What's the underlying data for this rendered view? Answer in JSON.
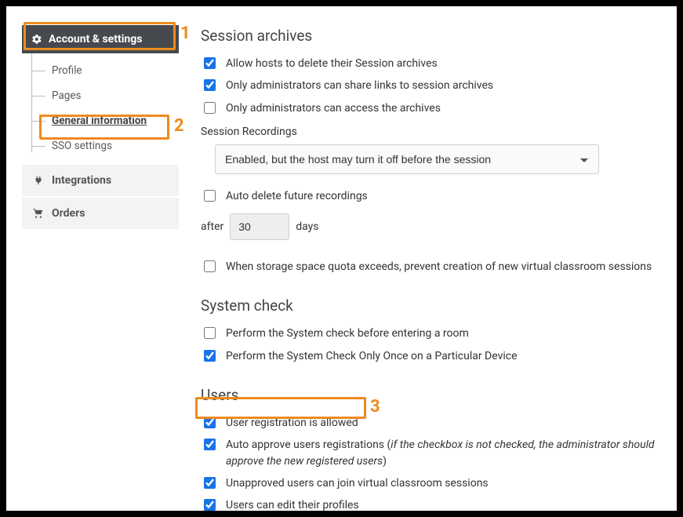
{
  "sidebar": {
    "header": "Account & settings",
    "items": [
      {
        "label": "Profile"
      },
      {
        "label": "Pages"
      },
      {
        "label": "General information"
      },
      {
        "label": "SSO settings"
      }
    ],
    "integrations": "Integrations",
    "orders": "Orders"
  },
  "sessionArchives": {
    "title": "Session archives",
    "allowDelete": "Allow hosts to delete their Session archives",
    "onlyAdminShare": "Only administrators can share links to session archives",
    "onlyAdminAccess": "Only administrators can access the archives",
    "recordingsLabel": "Session Recordings",
    "recordingsValue": "Enabled, but the host may turn it off before the session",
    "autoDelete": "Auto delete future recordings",
    "afterLabel": "after",
    "afterValue": "30",
    "daysLabel": "days",
    "storageQuota": "When storage space quota exceeds, prevent creation of new virtual classroom sessions"
  },
  "systemCheck": {
    "title": "System check",
    "before": "Perform the System check before entering a room",
    "once": "Perform the System Check Only Once on a Particular Device"
  },
  "users": {
    "title": "Users",
    "regAllowed": "User registration is allowed",
    "autoApprovePrefix": "Auto approve users registrations (",
    "autoApproveItalic": "if the checkbox is not checked, the administrator should approve the new registered users",
    "autoApproveSuffix": ")",
    "unapproved": "Unapproved users can join virtual classroom sessions",
    "editProfiles": "Users can edit their profiles"
  },
  "annotations": {
    "n1": "1",
    "n2": "2",
    "n3": "3"
  }
}
